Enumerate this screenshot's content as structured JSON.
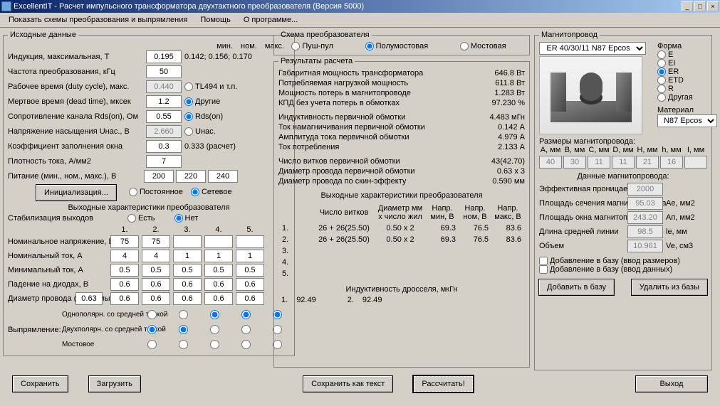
{
  "titlebar": {
    "title": "ExcellentIT - Расчет импульсного трансформатора двухтактного преобразователя (Версия 5000)"
  },
  "menubar": {
    "schemes": "Показать схемы преобразования и выпрямления",
    "help": "Помощь",
    "about": "О программе..."
  },
  "left": {
    "group_title": "Исходные данные",
    "cols": {
      "min": "мин.",
      "nom": "ном.",
      "max": "макс."
    },
    "induction_label": "Индукция, максимальная, Т",
    "induction_val": "0.195",
    "induction_min": "0.142;",
    "induction_nom": "0.156;",
    "induction_max": "0.170",
    "freq_label": "Частота преобразования, кГц",
    "freq_val": "50",
    "duty_label": "Рабочее время (duty cycle), макс.",
    "duty_val": "0.440",
    "rc_tl494": "TL494 и т.п.",
    "dead_label": "Мертвое время (dead time), мксек",
    "dead_val": "1.2",
    "rc_drugie": "Другие",
    "rds_label": "Сопротивление канала Rds(on), Ом",
    "rds_val": "0.55",
    "rc_rdson": "Rds(on)",
    "uhac_label": "Напряжение насыщения Uнас., В",
    "uhac_val": "2.660",
    "rc_uhac": "Uнас.",
    "koef_label": "Коэффициент заполнения окна",
    "koef_val": "0.3",
    "koef_calc": "0.333 (расчет)",
    "jdens_label": "Плотность тока, А/мм2",
    "jdens_val": "7",
    "supply_label": "Питание (мин., ном., макс.), В",
    "supply_min": "200",
    "supply_nom": "220",
    "supply_max": "240",
    "init_btn": "Инициализация...",
    "rc_const": "Постоянное",
    "rc_net": "Сетевое",
    "out_title": "Выходные характеристики преобразователя",
    "stab_label": "Стабилизация выходов",
    "rc_yes": "Есть",
    "rc_no": "Нет",
    "c1": "1.",
    "c2": "2.",
    "c3": "3.",
    "c4": "4.",
    "c5": "5.",
    "vnom_label": "Номинальное напряжение, В",
    "vnom": [
      "75",
      "75",
      "",
      "",
      ""
    ],
    "inom_label": "Номинальный ток, А",
    "inom": [
      "4",
      "4",
      "1",
      "1",
      "1"
    ],
    "imin_label": "Минимальный ток, А",
    "imin": [
      "0.5",
      "0.5",
      "0.5",
      "0.5",
      "0.5"
    ],
    "vdiode_label": "Падение на диодах, В",
    "vdiode": [
      "0.6",
      "0.6",
      "0.6",
      "0.6",
      "0.6"
    ],
    "dwire_label": "Диаметр провода (желаемый)",
    "dwire_main": "0.63",
    "dwire": [
      "0.6",
      "0.6",
      "0.6",
      "0.6",
      "0.6"
    ],
    "rect_label": "Выпрямление:",
    "rect_opts": [
      "Однополярн. со средней точкой",
      "Двухполярн. со средней точкой",
      "Мостовое"
    ],
    "save_btn": "Сохранить",
    "load_btn": "Загрузить"
  },
  "mid": {
    "scheme_title": "Схема преобразователя",
    "rc_push": "Пуш-пул",
    "rc_half": "Полумостовая",
    "rc_full": "Мостовая",
    "res_title": "Результаты расчета",
    "lines": [
      {
        "l": "Габаритная мощность трансформатора",
        "v": "646.8 Вт"
      },
      {
        "l": "Потребляемая нагрузкой мощность",
        "v": "611.8 Вт"
      },
      {
        "l": "Мощность потерь в магнитопроводе",
        "v": "1.283 Вт"
      },
      {
        "l": "КПД без учета потерь в обмотках",
        "v": "97.230 %"
      }
    ],
    "lines2": [
      {
        "l": "Индуктивность первичной обмотки",
        "v": "4.483 мГн"
      },
      {
        "l": "Ток намагничивания первичной обмотки",
        "v": "0.142 А"
      },
      {
        "l": "Амплитуда тока первичной обмотки",
        "v": "4.979 А"
      },
      {
        "l": "Ток потребления",
        "v": "2.133 А"
      }
    ],
    "lines3": [
      {
        "l": "Число витков первичной обмотки",
        "v": "43(42.70)"
      },
      {
        "l": "Диаметр провода первичной обмотки",
        "v": "0.63 x 3"
      },
      {
        "l": "Диаметр провода по скин-эффекту",
        "v": "0.590 мм"
      }
    ],
    "out_title": "Выходные характеристики преобразователя",
    "out_hdr": {
      "turns": "Число витков",
      "wire": "Диаметр мм х число жил",
      "vmin": "Напр. мин, В",
      "vnom": "Напр. ном, В",
      "vmax": "Напр. макс, В"
    },
    "out_rows": [
      {
        "n": "1.",
        "turns": "26 + 26(25.50)",
        "wire": "0.50 x 2",
        "vmin": "69.3",
        "vnom": "76.5",
        "vmax": "83.6"
      },
      {
        "n": "2.",
        "turns": "26 + 26(25.50)",
        "wire": "0.50 x 2",
        "vmin": "69.3",
        "vnom": "76.5",
        "vmax": "83.6"
      },
      {
        "n": "3.",
        "turns": "",
        "wire": "",
        "vmin": "",
        "vnom": "",
        "vmax": ""
      },
      {
        "n": "4.",
        "turns": "",
        "wire": "",
        "vmin": "",
        "vnom": "",
        "vmax": ""
      },
      {
        "n": "5.",
        "turns": "",
        "wire": "",
        "vmin": "",
        "vnom": "",
        "vmax": ""
      }
    ],
    "choke_title": "Индуктивность дросселя, мкГн",
    "choke_row": {
      "n": "1.",
      "v": "92.49",
      "n2": "2.",
      "v2": "92.49"
    },
    "save_text_btn": "Сохранить как текст",
    "calc_btn": "Рассчитать!"
  },
  "right": {
    "group_title": "Магнитопровод",
    "core_sel": "ER 40/30/11 N87 Epcos",
    "shape_label": "Форма",
    "shapes": [
      "E",
      "EI",
      "ER",
      "ETD",
      "R",
      "Другая"
    ],
    "material_label": "Материал",
    "material_sel": "N87 Epcos",
    "dims_title": "Размеры магнитопровода:",
    "dim_hdr": [
      "A, мм",
      "B, мм",
      "C, мм",
      "D, мм",
      "H, мм",
      "h, мм",
      "I, мм"
    ],
    "dims": [
      "40",
      "30",
      "11",
      "11",
      "21",
      "16",
      ""
    ],
    "data_title": "Данные магнитопровода:",
    "perm_label": "Эффективная проницаемость",
    "perm_val": "2000",
    "ae_label": "Площадь сечения магнитопровода",
    "ae_val": "95.03",
    "ae_u": "Ae, мм2",
    "ap_label": "Площадь окна магнитопровода",
    "ap_val": "243.20",
    "ap_u": "Ап, мм2",
    "le_label": "Длина средней линии",
    "le_val": "98.5",
    "le_u": "le, мм",
    "ve_label": "Объем",
    "ve_val": "10.961",
    "ve_u": "Ve, см3",
    "chk_add_size": "Добавление в базу (ввод размеров)",
    "chk_add_data": "Добавление в базу (ввод данных)",
    "add_btn": "Добавить в базу",
    "del_btn": "Удалить из базы",
    "exit_btn": "Выход"
  }
}
